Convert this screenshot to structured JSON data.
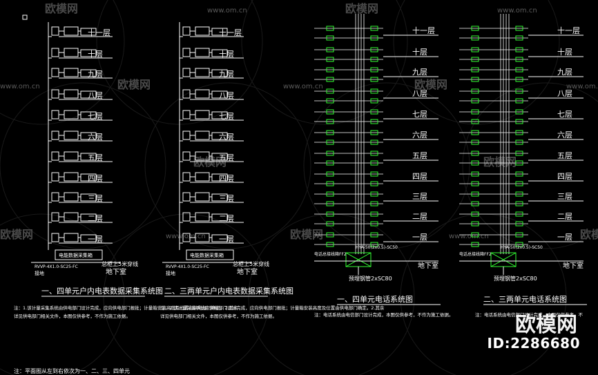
{
  "floors": [
    "十一层",
    "十层",
    "九层",
    "八层",
    "七层",
    "六层",
    "五层",
    "四层",
    "三层",
    "二层",
    "一层"
  ],
  "basement": "地下室",
  "panels": [
    {
      "title": "一、四单元户内电表数据采集系统图",
      "note": "注：1.该计量采集系统由供电部门设计完成，应向供电部门报批；计量箱安装高度及位置由供电部门确定。2.其余详见供电部门相关文件，本图仅供参考，不作为施工依据。",
      "box_label": "电能数据采集箱",
      "cable_label": "RVVP-4X1.0-SC25-FC",
      "wall_label": "总柜上5米穿线",
      "grounding_label": "接地"
    },
    {
      "title": "二、三两单元户内电表数据采集系统图",
      "note": "注：1.该计量采集系统由供电部门设计完成，应向供电部门报批；计量箱安装高度及位置由供电部门确定。2.其余详见供电部门相关文件，本图仅供参考，不作为施工依据。",
      "box_label": "电能数据采集箱",
      "cable_label": "RVVP-4X1.0-SC25-FC",
      "wall_label": "总柜上5米穿线",
      "grounding_label": "接地"
    },
    {
      "title": "一、四单元电话系统图",
      "note": "注：电话系统由电信部门设计完成，本图仅供参考，不作为施工依据。",
      "box_label": "电话总接线箱FF2",
      "cable_label": "HYA-50(2x0.5)-SC50",
      "pipe_label": "预埋钢管2xSC80",
      "wall_label": "地下室"
    },
    {
      "title": "二、三两单元电话系统图",
      "note": "注：电话系统由电信部门设计完成，本图仅供参考，不作为施工依据。",
      "box_label": "电话总接线箱FF2",
      "cable_label": "HYA-50(2x0.5)-SC50",
      "pipe_label": "预埋钢管2xSC80",
      "wall_label": "地下室"
    }
  ],
  "footer_note": "注：平面图从左到右依次为一、二、三、四单元",
  "watermark": {
    "site": "www.om.cn",
    "brand": "欧模网",
    "id": "ID:2286680"
  },
  "colors": {
    "line": "#ffffff",
    "accent_green": "#33ff33",
    "background": "#000000"
  }
}
